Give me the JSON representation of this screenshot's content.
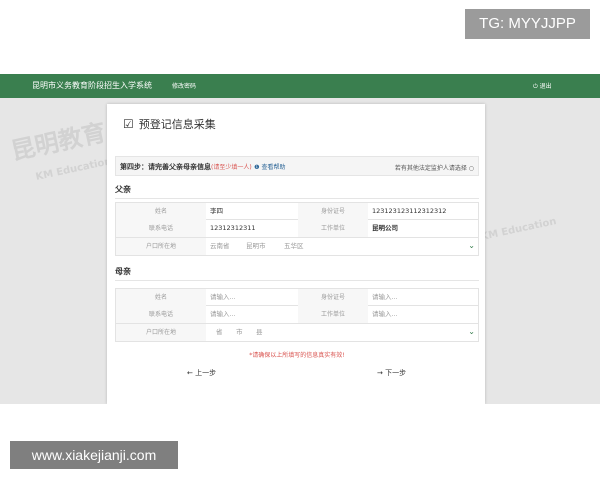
{
  "overlay": {
    "tg": "TG: MYYJJPP",
    "site": "www.xiakejianji.com"
  },
  "topbar": {
    "system": "昆明市义务教育阶段招生入学系统",
    "change_password": "修改密码",
    "logout": "退出"
  },
  "panel": {
    "title": "预登记信息采集"
  },
  "step": {
    "title": "第四步：请完善父亲母亲信息",
    "note": "(请至少填一人)",
    "help": "查看帮助",
    "other": "若有其他法定监护人请选择"
  },
  "father": {
    "label": "父亲",
    "name_label": "姓名",
    "name_value": "李四",
    "id_label": "身份证号",
    "id_value": "123123123112312312",
    "phone_label": "联系电话",
    "phone_value": "12312312311",
    "work_label": "工作单位",
    "work_value": "昆明公司",
    "hukou_label": "户口所在地",
    "province": "云南省",
    "city": "昆明市",
    "district": "五华区"
  },
  "mother": {
    "label": "母亲",
    "name_label": "姓名",
    "name_ph": "请输入...",
    "id_label": "身份证号",
    "id_ph": "请输入...",
    "phone_label": "联系电话",
    "phone_ph": "请输入...",
    "work_label": "工作单位",
    "work_ph": "请输入...",
    "hukou_label": "户口所在地",
    "province": "省",
    "city": "市",
    "district": "县"
  },
  "warning": "*请确保以上所填写的信息真实有效!",
  "buttons": {
    "prev": "上一步",
    "next": "下一步"
  },
  "watermark": {
    "text": "昆明教育",
    "sub": "KM Education"
  },
  "colors": {
    "header": "#3a7f4f",
    "warning": "#d9534f"
  }
}
